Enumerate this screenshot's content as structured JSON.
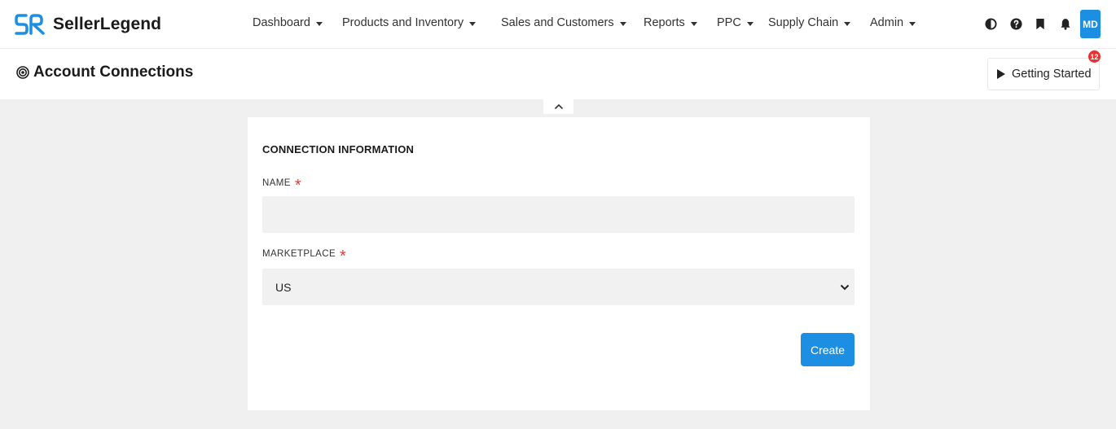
{
  "brand": {
    "name": "SellerLegend",
    "accent": "#1d8fe3"
  },
  "nav": {
    "items": [
      {
        "label": "Dashboard"
      },
      {
        "label": "Products and Inventory"
      },
      {
        "label": "Sales and Customers"
      },
      {
        "label": "Reports"
      },
      {
        "label": "PPC"
      },
      {
        "label": "Supply Chain"
      },
      {
        "label": "Admin"
      }
    ],
    "icons": [
      "contrast-icon",
      "help-icon",
      "bookmark-icon",
      "bell-icon"
    ],
    "avatar_initials": "MD"
  },
  "page": {
    "title": "Account Connections",
    "getting_started_label": "Getting Started",
    "getting_started_badge": "12"
  },
  "form": {
    "section_title": "CONNECTION INFORMATION",
    "name_label": "NAME",
    "name_value": "",
    "required_mark": "*",
    "marketplace_label": "MARKETPLACE",
    "marketplace_value": "US",
    "submit_label": "Create"
  }
}
